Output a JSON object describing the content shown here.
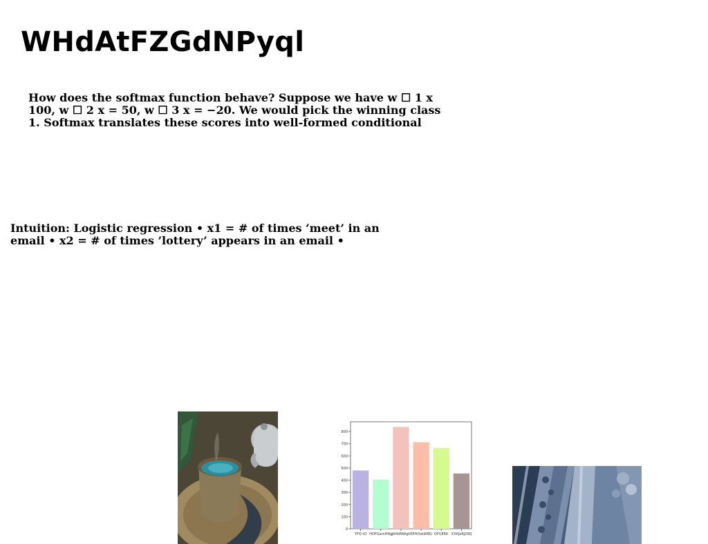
{
  "page": {
    "title": "WHdAtFZGdNPyql",
    "paragraph_1": "How does the softmax function behave? Suppose we have w ☐ 1 x 100, w ☐ 2 x = 50, w ☐ 3 x = −20. We would pick the winning class 1. Softmax translates these scores into well-formed conditional",
    "paragraph_2": "Intuition: Logistic regression • x1 = # of times ’meet’ in an email • x2 = # of times ’lottery’ appears in an email •"
  },
  "images": {
    "left": "teapot-and-cup-photo",
    "right": "carved-stone-balustrade-photo"
  },
  "chart_data": {
    "type": "bar",
    "categories": [
      "YFQ tO",
      "HOFGamHNg",
      "JAHdNWgk",
      "EEHOskWBG",
      "OFUERK",
      "XXHJsRJZWJ"
    ],
    "values": [
      480,
      405,
      838,
      712,
      665,
      455
    ],
    "colors": [
      "#bab2e0",
      "#b3fdd2",
      "#f4c2bc",
      "#fdbda7",
      "#d5fb8f",
      "#a69592"
    ],
    "yticks": [
      0,
      100,
      200,
      300,
      400,
      500,
      600,
      700,
      800
    ],
    "ylim": [
      0,
      880
    ],
    "title": "",
    "xlabel": "",
    "ylabel": "",
    "grid": false
  }
}
